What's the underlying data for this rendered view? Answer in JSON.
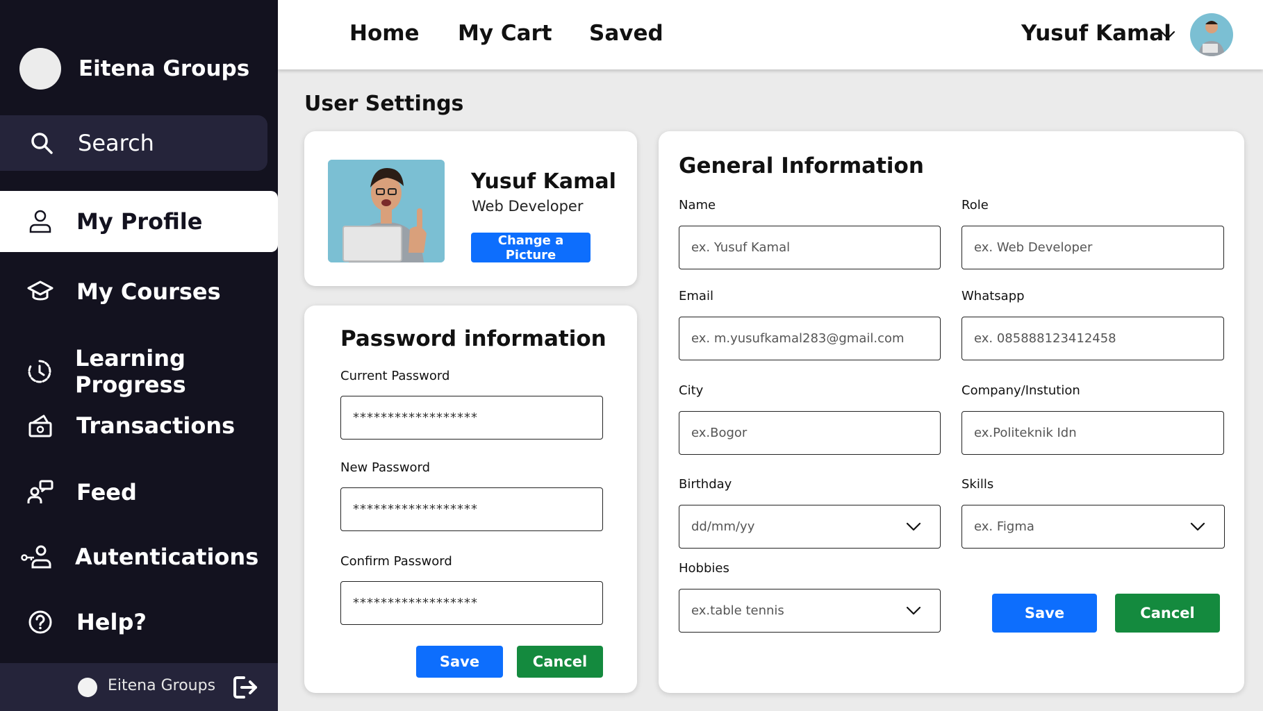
{
  "sidebar": {
    "brand": "Eitena Groups",
    "items": [
      {
        "label": "Search",
        "icon": "search-icon"
      },
      {
        "label": "My Profile",
        "icon": "user-icon"
      },
      {
        "label": "My Courses",
        "icon": "graduation-cap-icon"
      },
      {
        "label": "Learning Progress",
        "icon": "history-clock-icon"
      },
      {
        "label": "Transactions",
        "icon": "cash-box-icon"
      },
      {
        "label": "Feed",
        "icon": "user-chat-icon"
      },
      {
        "label": "Autentications",
        "icon": "user-key-icon"
      },
      {
        "label": "Help?",
        "icon": "help-icon"
      }
    ],
    "footer_name": "Eitena Groups"
  },
  "topbar": {
    "links": [
      "Home",
      "My Cart",
      "Saved"
    ],
    "user_name": "Yusuf Kamal"
  },
  "page_title": "User Settings",
  "profile": {
    "name": "Yusuf Kamal",
    "role": "Web Developer",
    "change_picture": "Change a Picture"
  },
  "password": {
    "title": "Password information",
    "current_label": "Current Password",
    "current_value": "******************",
    "new_label": "New Password",
    "new_value": "******************",
    "confirm_label": "Confirm Password",
    "confirm_value": "******************",
    "save": "Save",
    "cancel": "Cancel"
  },
  "general": {
    "title": "General Information",
    "name_label": "Name",
    "name_placeholder": "ex. Yusuf Kamal",
    "role_label": "Role",
    "role_placeholder": "ex. Web Developer",
    "email_label": "Email",
    "email_placeholder": "ex. m.yusufkamal283@gmail.com",
    "whatsapp_label": "Whatsapp",
    "whatsapp_placeholder": "ex. 085888123412458",
    "city_label": "City",
    "city_placeholder": "ex.Bogor",
    "company_label": "Company/Instution",
    "company_placeholder": "ex.Politeknik Idn",
    "birthday_label": "Birthday",
    "birthday_value": "dd/mm/yy",
    "skills_label": "Skills",
    "skills_value": "ex. Figma",
    "hobbies_label": "Hobbies",
    "hobbies_value": "ex.table tennis",
    "save": "Save",
    "cancel": "Cancel"
  },
  "colors": {
    "sidebar_bg": "#13121f",
    "primary_blue": "#0d6efd",
    "cancel_green": "#148a3e",
    "page_bg": "#ebebeb"
  }
}
